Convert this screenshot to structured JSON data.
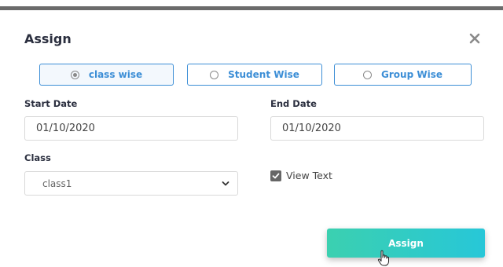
{
  "modal": {
    "title": "Assign",
    "close_icon": "close-icon"
  },
  "assign_type": {
    "options": [
      {
        "label": "class wise",
        "selected": true
      },
      {
        "label": "Student Wise",
        "selected": false
      },
      {
        "label": "Group Wise",
        "selected": false
      }
    ]
  },
  "start_date": {
    "label": "Start Date",
    "value": "01/10/2020"
  },
  "end_date": {
    "label": "End Date",
    "value": "01/10/2020"
  },
  "class_select": {
    "label": "Class",
    "value": "class1",
    "icon": "chevron-down-icon"
  },
  "view_text": {
    "label": "View Text",
    "checked": true
  },
  "submit": {
    "label": "Assign"
  },
  "colors": {
    "accent": "#3c8ed6",
    "button_gradient_start": "#3bd0b0",
    "button_gradient_end": "#27c7d8",
    "top_bar": "#6b6b6b"
  }
}
